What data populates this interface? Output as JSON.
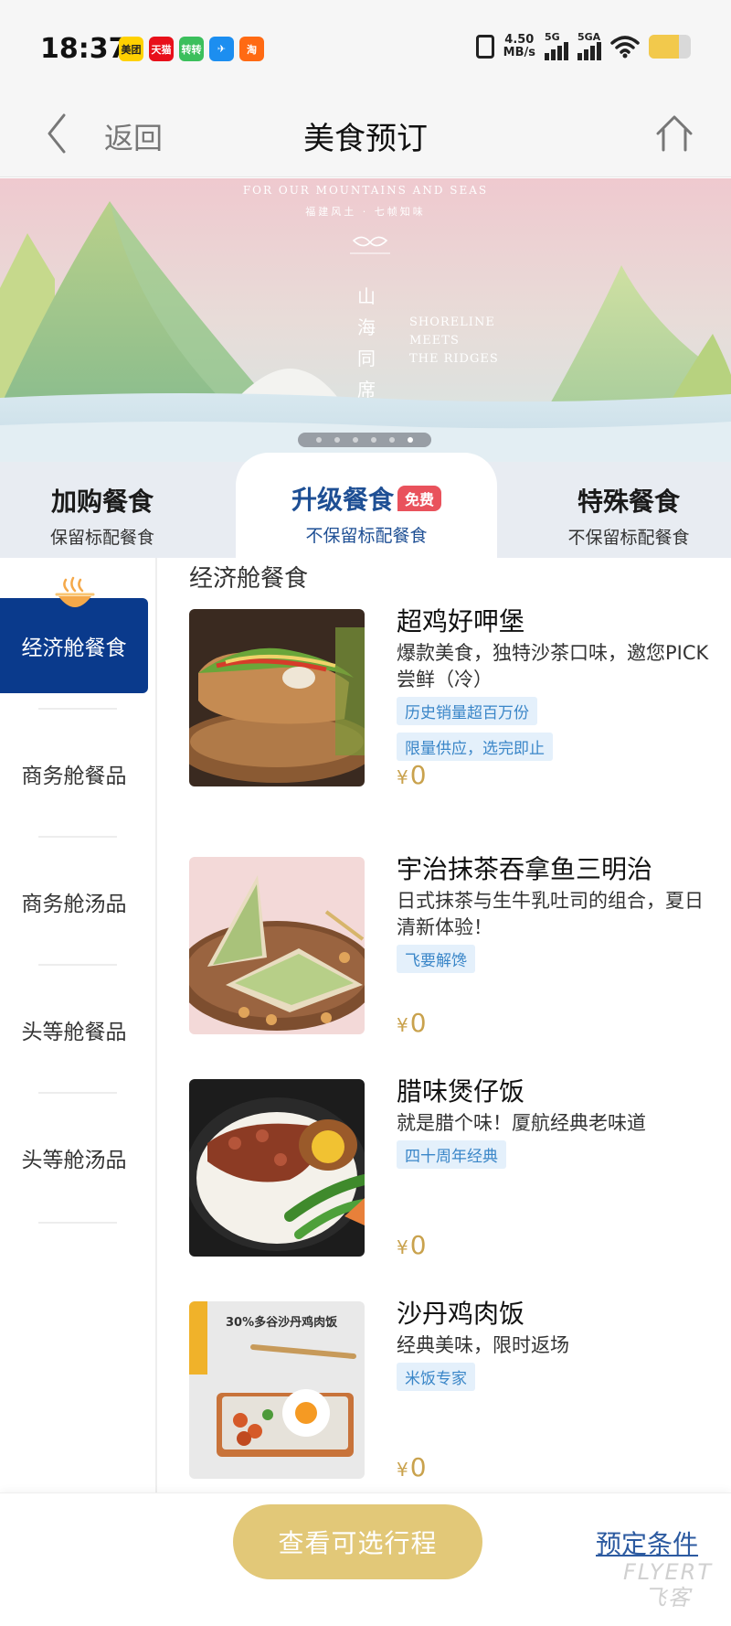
{
  "status_bar": {
    "time": "18:37",
    "app_icons": [
      {
        "name": "meituan-app-icon",
        "label": "美团",
        "color": "#ffd100",
        "text_color": "#222222"
      },
      {
        "name": "tmall-app-icon",
        "label": "天猫",
        "color": "#e8101a",
        "text_color": "#ffffff"
      },
      {
        "name": "zhuanzhuan-app-icon",
        "label": "转转",
        "color": "#3bbf5c",
        "text_color": "#ffffff"
      },
      {
        "name": "flight-app-icon",
        "label": "✈",
        "color": "#1c8ef0",
        "text_color": "#ffffff"
      },
      {
        "name": "taobao-app-icon",
        "label": "淘",
        "color": "#ff6a13",
        "text_color": "#ffffff"
      }
    ],
    "net_speed_value": "4.50",
    "net_speed_unit": "MB/s",
    "signal_1_label": "5G",
    "signal_2_label": "5GA",
    "battery_level": 0.72,
    "battery_color": "#f2c94c"
  },
  "nav": {
    "back_label": "返回",
    "title": "美食预订"
  },
  "banner": {
    "headline": "FOR OUR MOUNTAINS AND SEAS",
    "subline": "福建风土 · 七帧知味",
    "vertical_text": [
      "山",
      "海",
      "同",
      "席"
    ],
    "english_lines": [
      "SHORELINE",
      "MEETS",
      "THE RIDGES"
    ],
    "slide_count": 6,
    "active_slide": 5
  },
  "meal_tabs": [
    {
      "title": "加购餐食",
      "subtitle": "保留标配餐食",
      "active": false
    },
    {
      "title": "升级餐食",
      "subtitle": "不保留标配餐食",
      "active": true,
      "badge": "免费"
    },
    {
      "title": "特殊餐食",
      "subtitle": "不保留标配餐食",
      "active": false
    }
  ],
  "sidebar": {
    "items": [
      {
        "label": "经济舱餐食",
        "active": true
      },
      {
        "label": "商务舱餐品",
        "active": false
      },
      {
        "label": "商务舱汤品",
        "active": false
      },
      {
        "label": "头等舱餐品",
        "active": false
      },
      {
        "label": "头等舱汤品",
        "active": false
      }
    ]
  },
  "section": {
    "title": "经济舱餐食"
  },
  "meals": [
    {
      "name": "超鸡好呷堡",
      "description": "爆款美食，独特沙茶口味，邀您PICK尝鲜（冷）",
      "tags": [
        "历史销量超百万份",
        "限量供应，选完即止"
      ],
      "currency": "¥",
      "price": "0"
    },
    {
      "name": "宇治抹茶吞拿鱼三明治",
      "description": "日式抹茶与生牛乳吐司的组合，夏日清新体验！",
      "tags": [
        "飞要解馋"
      ],
      "currency": "¥",
      "price": "0"
    },
    {
      "name": "腊味煲仔饭",
      "description": "就是腊个味！厦航经典老味道",
      "tags": [
        "四十周年经典"
      ],
      "currency": "¥",
      "price": "0"
    },
    {
      "name": "沙丹鸡肉饭",
      "description": "经典美味，限时返场",
      "tags": [
        "米饭专家"
      ],
      "currency": "¥",
      "price": "0",
      "image_caption": "30%多谷沙丹鸡肉饭"
    }
  ],
  "bottom_bar": {
    "cta_label": "查看可选行程",
    "conditions_label": "预定条件",
    "watermark_en": "FLYERT",
    "watermark_cn": "飞客"
  },
  "colors": {
    "brand_navy": "#0a3a8c",
    "tab_active_text": "#1e4f94",
    "badge_red": "#e9525c",
    "tag_bg": "#e4f0fb",
    "tag_text": "#3a86c8",
    "price_gold": "#c9a24d",
    "cta_gold": "#e2c878",
    "link_blue": "#2c5aa0"
  }
}
